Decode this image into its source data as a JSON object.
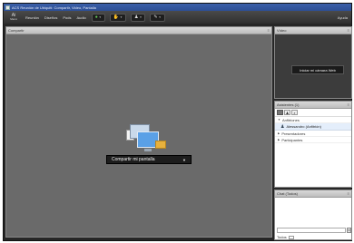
{
  "window": {
    "title": "ACS Reunión de Ubiquiti: Compartir, Video, Pantalla"
  },
  "menubar": {
    "logo_glyph": "Ai",
    "logo_label": "Menú",
    "items": [
      "Reunión",
      "Diseños",
      "Pods",
      "Audio"
    ],
    "right_label": "Ayuda"
  },
  "share_pod": {
    "title": "Compartir",
    "menu_icon": "≡",
    "share_button_label": "Compartir mi pantalla",
    "share_button_caret": "▼"
  },
  "video_pod": {
    "title": "Vídeo",
    "menu_icon": "≡",
    "start_camera_label": "Iniciar mi cámara Web"
  },
  "attendees_pod": {
    "title": "Asistentes (1)",
    "menu_icon": "≡",
    "groups": [
      {
        "label": "Anfitriones"
      },
      {
        "label": "Presentadores"
      },
      {
        "label": "Participantes"
      }
    ],
    "attendee_name": "Alessandro (Anfitrión)"
  },
  "chat_pod": {
    "title": "Chat (Todos)",
    "menu_icon": "≡",
    "send_icon": "✉",
    "to_label": "Todos"
  },
  "colors": {
    "title_bar": "#3a5fa9",
    "stage_bg": "#6a6a6a",
    "mic_green": "#66d05a",
    "attendee_highlight": "#e4eefb"
  }
}
